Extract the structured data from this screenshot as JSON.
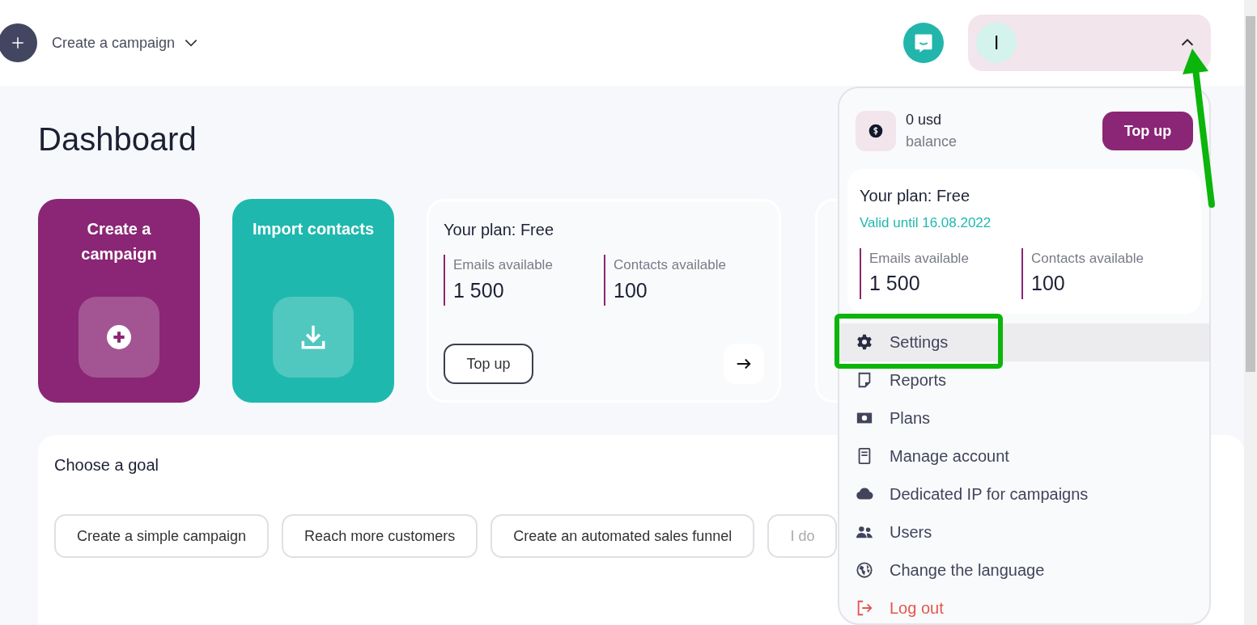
{
  "header": {
    "create_menu": {
      "label": "Create a campaign"
    },
    "account": {
      "initial": "I",
      "expanded": true
    }
  },
  "title": "Dashboard",
  "tiles": [
    {
      "kind": "create",
      "label": "Create a campaign",
      "color": "#8a2675"
    },
    {
      "kind": "import",
      "label": "Import contacts",
      "color": "#1fb8ae"
    }
  ],
  "plan_card": {
    "title": "Your plan: Free",
    "stats": [
      {
        "label": "Emails available",
        "value": "1 500"
      },
      {
        "label": "Contacts available",
        "value": "100"
      }
    ],
    "button": "Top up"
  },
  "goals": {
    "title": "Choose a goal",
    "options": [
      "Create a simple campaign",
      "Reach more customers",
      "Create an automated sales funnel",
      "I do"
    ]
  },
  "account_menu": {
    "balance": {
      "amount": "0 usd",
      "label": "balance"
    },
    "top_up": "Top up",
    "plan": {
      "title": "Your plan: Free",
      "valid": "Valid until 16.08.2022",
      "stats": [
        {
          "label": "Emails available",
          "value": "1 500"
        },
        {
          "label": "Contacts available",
          "value": "100"
        }
      ]
    },
    "items": [
      {
        "kind": "gear",
        "label": "Settings",
        "selected": true
      },
      {
        "kind": "report",
        "label": "Reports",
        "selected": false
      },
      {
        "kind": "money",
        "label": "Plans",
        "selected": false
      },
      {
        "kind": "book",
        "label": "Manage account",
        "selected": false
      },
      {
        "kind": "cloud",
        "label": "Dedicated IP for campaigns",
        "selected": false
      },
      {
        "kind": "users",
        "label": "Users",
        "selected": false
      },
      {
        "kind": "globe",
        "label": "Change the language",
        "selected": false
      },
      {
        "kind": "logout",
        "label": "Log out",
        "selected": false
      }
    ]
  }
}
